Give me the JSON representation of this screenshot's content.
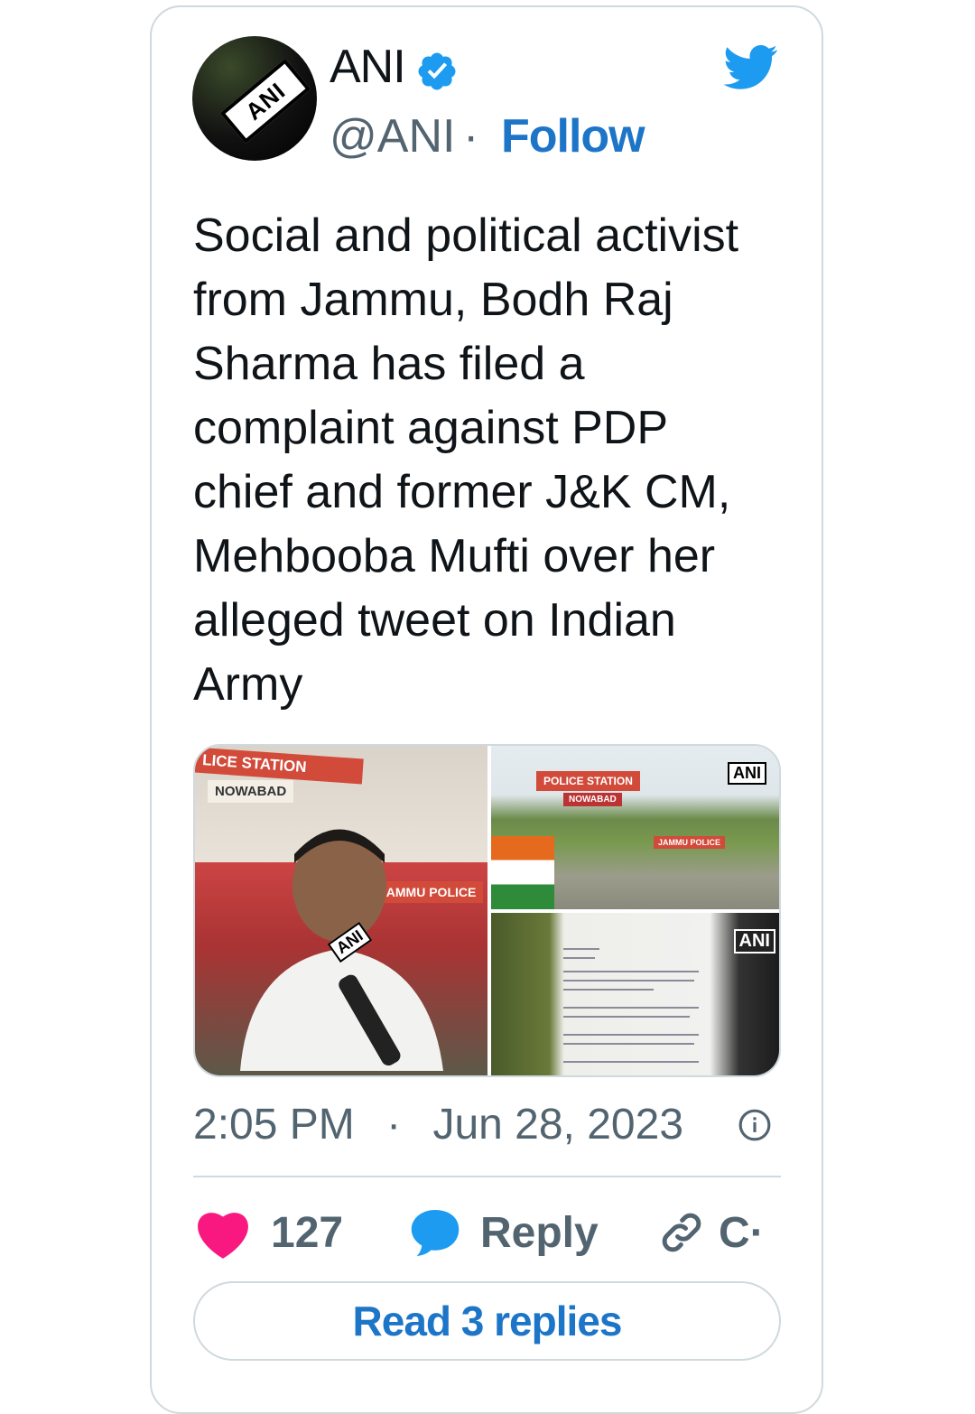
{
  "author": {
    "name": "ANI",
    "handle": "@ANI",
    "separator": "·",
    "follow_label": "Follow",
    "avatar_text": "ANI"
  },
  "tweet": {
    "text": "Social and political activist\nfrom Jammu, Bodh Raj\nSharma has filed a\ncomplaint against PDP\nchief and former J&K CM,\nMehbooba Mufti over her\nalleged tweet on Indian\nArmy",
    "media": {
      "photo1": {
        "sign_text": "LICE STATION",
        "sign_sub": "NOWABAD",
        "gate_sign": "JAMMU POLICE",
        "mic_text": "ANI"
      },
      "photo2": {
        "sign_text": "POLICE STATION",
        "sign_sub": "NOWABAD",
        "bug": "ANI",
        "gate_sign": "JAMMU POLICE"
      },
      "photo3": {
        "bug": "ANI"
      }
    },
    "time": "2:05 PM",
    "date": "Jun 28, 2023",
    "timestamp_separator": "·"
  },
  "actions": {
    "likes": "127",
    "reply_label": "Reply",
    "copy_label": "C·"
  },
  "read_replies_label": "Read 3 replies",
  "colors": {
    "accent": "#1d75c8",
    "like": "#f91880",
    "reply": "#1d9bf0",
    "border": "#cfd9de",
    "muted": "#536471"
  },
  "icons": [
    "verified-badge-icon",
    "twitter-bird-icon",
    "info-icon",
    "heart-icon",
    "reply-bubble-icon",
    "link-icon"
  ]
}
